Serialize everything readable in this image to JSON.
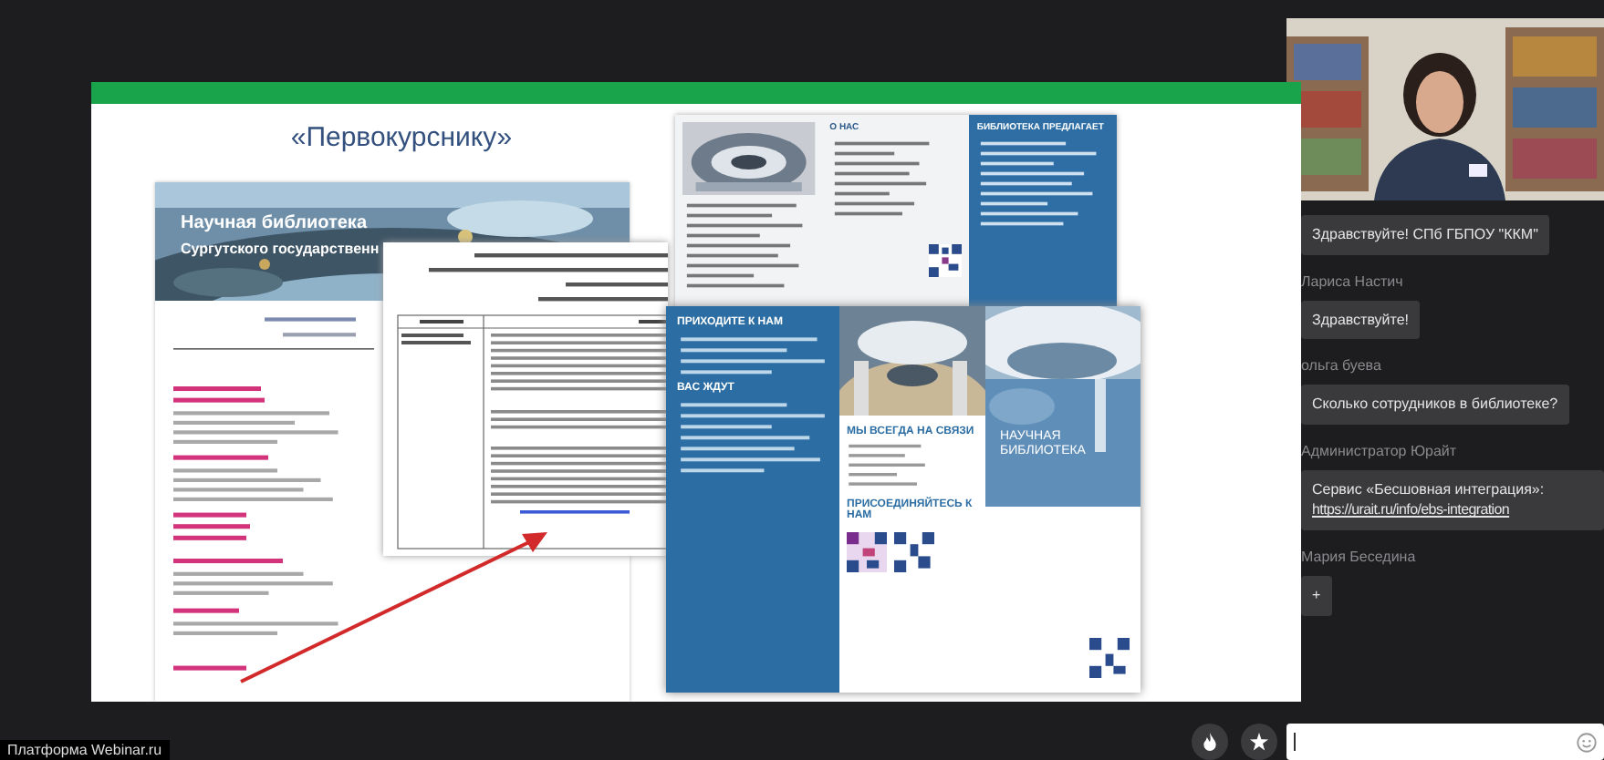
{
  "slide": {
    "title": "«Первокурснику»",
    "banner": {
      "title": "Научная библиотека",
      "subtitle": "Сургутского государственн"
    },
    "top_brochure": {
      "headings": [
        "О НАС",
        "БИБЛИОТЕКА ПРЕДЛАГАЕТ"
      ]
    },
    "brochure": {
      "left_headings": [
        "ПРИХОДИТЕ К НАМ",
        "ВАС ЖДУТ"
      ],
      "middle_headings": [
        "МЫ ВСЕГДА НА СВЯЗИ",
        "ПРИСОЕДИНЯЙТЕСЬ К НАМ"
      ],
      "cover_title": "НАУЧНАЯ БИБЛИОТЕКА"
    }
  },
  "chat": {
    "messages": [
      {
        "text": "Здравствуйте! СПб ГБПОУ \"ККМ\""
      },
      {
        "author": "Лариса Настич",
        "text": "Здравствуйте!"
      },
      {
        "author": "ольга буева",
        "text": "Сколько сотрудников  в библиотеке?"
      },
      {
        "author": "Администратор Юрайт",
        "text": "Сервис «Бесшовная интеграция»: ",
        "link": "https://urait.ru/info/ebs-integration"
      },
      {
        "author": "Мария Беседина",
        "text": "+"
      }
    ]
  },
  "footer": {
    "platform": "Платформа Webinar.ru"
  }
}
